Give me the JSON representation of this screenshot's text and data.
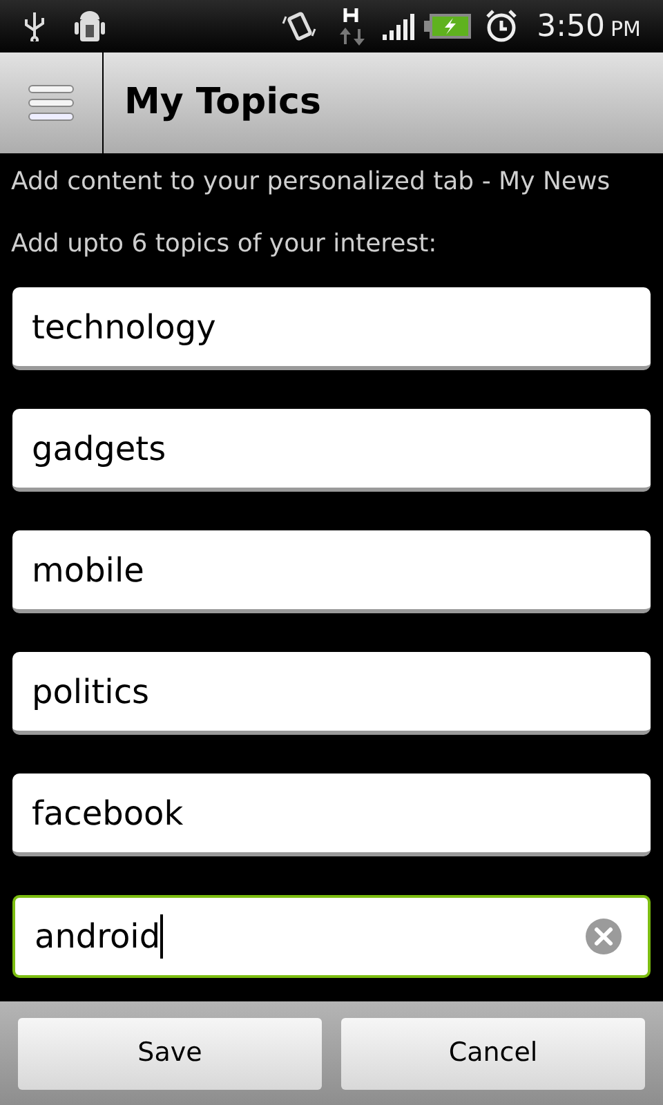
{
  "status_bar": {
    "time": "3:50",
    "meridiem": "PM"
  },
  "header": {
    "title": "My Topics"
  },
  "intro": "Add content to your personalized tab - My News",
  "prompt": "Add upto 6 topics of your interest:",
  "topics": [
    {
      "value": "technology",
      "focused": false
    },
    {
      "value": "gadgets",
      "focused": false
    },
    {
      "value": "mobile",
      "focused": false
    },
    {
      "value": "politics",
      "focused": false
    },
    {
      "value": "facebook",
      "focused": false
    },
    {
      "value": "android",
      "focused": true
    }
  ],
  "buttons": [
    "Save",
    "Cancel"
  ]
}
